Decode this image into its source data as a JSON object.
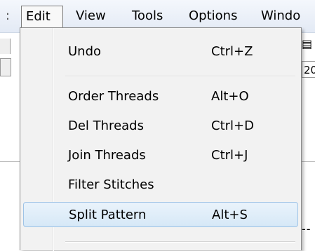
{
  "menubar": {
    "left_edge": ":",
    "items": [
      "Edit",
      "View",
      "Tools",
      "Options",
      "Windo"
    ]
  },
  "background": {
    "right_field_text": "20",
    "right_dashes": "--"
  },
  "edit_menu": {
    "items": [
      {
        "label": "Undo",
        "shortcut": "Ctrl+Z"
      },
      {
        "label": "Order Threads",
        "shortcut": "Alt+O"
      },
      {
        "label": "Del Threads",
        "shortcut": "Ctrl+D"
      },
      {
        "label": "Join Threads",
        "shortcut": "Ctrl+J"
      },
      {
        "label": "Filter Stitches",
        "shortcut": ""
      },
      {
        "label": "Split Pattern",
        "shortcut": "Alt+S"
      }
    ],
    "highlighted_item": "Split Pattern",
    "highlight_color": "#d6e8f7"
  }
}
